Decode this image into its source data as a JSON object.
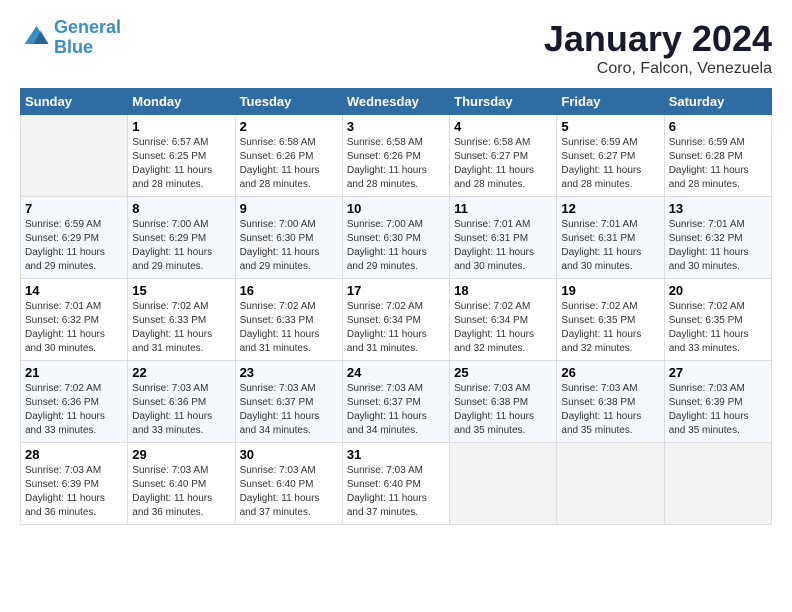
{
  "logo": {
    "line1": "General",
    "line2": "Blue"
  },
  "title": "January 2024",
  "subtitle": "Coro, Falcon, Venezuela",
  "columns": [
    "Sunday",
    "Monday",
    "Tuesday",
    "Wednesday",
    "Thursday",
    "Friday",
    "Saturday"
  ],
  "weeks": [
    [
      {
        "day": "",
        "sunrise": "",
        "sunset": "",
        "daylight": ""
      },
      {
        "day": "1",
        "sunrise": "Sunrise: 6:57 AM",
        "sunset": "Sunset: 6:25 PM",
        "daylight": "Daylight: 11 hours and 28 minutes."
      },
      {
        "day": "2",
        "sunrise": "Sunrise: 6:58 AM",
        "sunset": "Sunset: 6:26 PM",
        "daylight": "Daylight: 11 hours and 28 minutes."
      },
      {
        "day": "3",
        "sunrise": "Sunrise: 6:58 AM",
        "sunset": "Sunset: 6:26 PM",
        "daylight": "Daylight: 11 hours and 28 minutes."
      },
      {
        "day": "4",
        "sunrise": "Sunrise: 6:58 AM",
        "sunset": "Sunset: 6:27 PM",
        "daylight": "Daylight: 11 hours and 28 minutes."
      },
      {
        "day": "5",
        "sunrise": "Sunrise: 6:59 AM",
        "sunset": "Sunset: 6:27 PM",
        "daylight": "Daylight: 11 hours and 28 minutes."
      },
      {
        "day": "6",
        "sunrise": "Sunrise: 6:59 AM",
        "sunset": "Sunset: 6:28 PM",
        "daylight": "Daylight: 11 hours and 28 minutes."
      }
    ],
    [
      {
        "day": "7",
        "sunrise": "Sunrise: 6:59 AM",
        "sunset": "Sunset: 6:29 PM",
        "daylight": "Daylight: 11 hours and 29 minutes."
      },
      {
        "day": "8",
        "sunrise": "Sunrise: 7:00 AM",
        "sunset": "Sunset: 6:29 PM",
        "daylight": "Daylight: 11 hours and 29 minutes."
      },
      {
        "day": "9",
        "sunrise": "Sunrise: 7:00 AM",
        "sunset": "Sunset: 6:30 PM",
        "daylight": "Daylight: 11 hours and 29 minutes."
      },
      {
        "day": "10",
        "sunrise": "Sunrise: 7:00 AM",
        "sunset": "Sunset: 6:30 PM",
        "daylight": "Daylight: 11 hours and 29 minutes."
      },
      {
        "day": "11",
        "sunrise": "Sunrise: 7:01 AM",
        "sunset": "Sunset: 6:31 PM",
        "daylight": "Daylight: 11 hours and 30 minutes."
      },
      {
        "day": "12",
        "sunrise": "Sunrise: 7:01 AM",
        "sunset": "Sunset: 6:31 PM",
        "daylight": "Daylight: 11 hours and 30 minutes."
      },
      {
        "day": "13",
        "sunrise": "Sunrise: 7:01 AM",
        "sunset": "Sunset: 6:32 PM",
        "daylight": "Daylight: 11 hours and 30 minutes."
      }
    ],
    [
      {
        "day": "14",
        "sunrise": "Sunrise: 7:01 AM",
        "sunset": "Sunset: 6:32 PM",
        "daylight": "Daylight: 11 hours and 30 minutes."
      },
      {
        "day": "15",
        "sunrise": "Sunrise: 7:02 AM",
        "sunset": "Sunset: 6:33 PM",
        "daylight": "Daylight: 11 hours and 31 minutes."
      },
      {
        "day": "16",
        "sunrise": "Sunrise: 7:02 AM",
        "sunset": "Sunset: 6:33 PM",
        "daylight": "Daylight: 11 hours and 31 minutes."
      },
      {
        "day": "17",
        "sunrise": "Sunrise: 7:02 AM",
        "sunset": "Sunset: 6:34 PM",
        "daylight": "Daylight: 11 hours and 31 minutes."
      },
      {
        "day": "18",
        "sunrise": "Sunrise: 7:02 AM",
        "sunset": "Sunset: 6:34 PM",
        "daylight": "Daylight: 11 hours and 32 minutes."
      },
      {
        "day": "19",
        "sunrise": "Sunrise: 7:02 AM",
        "sunset": "Sunset: 6:35 PM",
        "daylight": "Daylight: 11 hours and 32 minutes."
      },
      {
        "day": "20",
        "sunrise": "Sunrise: 7:02 AM",
        "sunset": "Sunset: 6:35 PM",
        "daylight": "Daylight: 11 hours and 33 minutes."
      }
    ],
    [
      {
        "day": "21",
        "sunrise": "Sunrise: 7:02 AM",
        "sunset": "Sunset: 6:36 PM",
        "daylight": "Daylight: 11 hours and 33 minutes."
      },
      {
        "day": "22",
        "sunrise": "Sunrise: 7:03 AM",
        "sunset": "Sunset: 6:36 PM",
        "daylight": "Daylight: 11 hours and 33 minutes."
      },
      {
        "day": "23",
        "sunrise": "Sunrise: 7:03 AM",
        "sunset": "Sunset: 6:37 PM",
        "daylight": "Daylight: 11 hours and 34 minutes."
      },
      {
        "day": "24",
        "sunrise": "Sunrise: 7:03 AM",
        "sunset": "Sunset: 6:37 PM",
        "daylight": "Daylight: 11 hours and 34 minutes."
      },
      {
        "day": "25",
        "sunrise": "Sunrise: 7:03 AM",
        "sunset": "Sunset: 6:38 PM",
        "daylight": "Daylight: 11 hours and 35 minutes."
      },
      {
        "day": "26",
        "sunrise": "Sunrise: 7:03 AM",
        "sunset": "Sunset: 6:38 PM",
        "daylight": "Daylight: 11 hours and 35 minutes."
      },
      {
        "day": "27",
        "sunrise": "Sunrise: 7:03 AM",
        "sunset": "Sunset: 6:39 PM",
        "daylight": "Daylight: 11 hours and 35 minutes."
      }
    ],
    [
      {
        "day": "28",
        "sunrise": "Sunrise: 7:03 AM",
        "sunset": "Sunset: 6:39 PM",
        "daylight": "Daylight: 11 hours and 36 minutes."
      },
      {
        "day": "29",
        "sunrise": "Sunrise: 7:03 AM",
        "sunset": "Sunset: 6:40 PM",
        "daylight": "Daylight: 11 hours and 36 minutes."
      },
      {
        "day": "30",
        "sunrise": "Sunrise: 7:03 AM",
        "sunset": "Sunset: 6:40 PM",
        "daylight": "Daylight: 11 hours and 37 minutes."
      },
      {
        "day": "31",
        "sunrise": "Sunrise: 7:03 AM",
        "sunset": "Sunset: 6:40 PM",
        "daylight": "Daylight: 11 hours and 37 minutes."
      },
      {
        "day": "",
        "sunrise": "",
        "sunset": "",
        "daylight": ""
      },
      {
        "day": "",
        "sunrise": "",
        "sunset": "",
        "daylight": ""
      },
      {
        "day": "",
        "sunrise": "",
        "sunset": "",
        "daylight": ""
      }
    ]
  ]
}
